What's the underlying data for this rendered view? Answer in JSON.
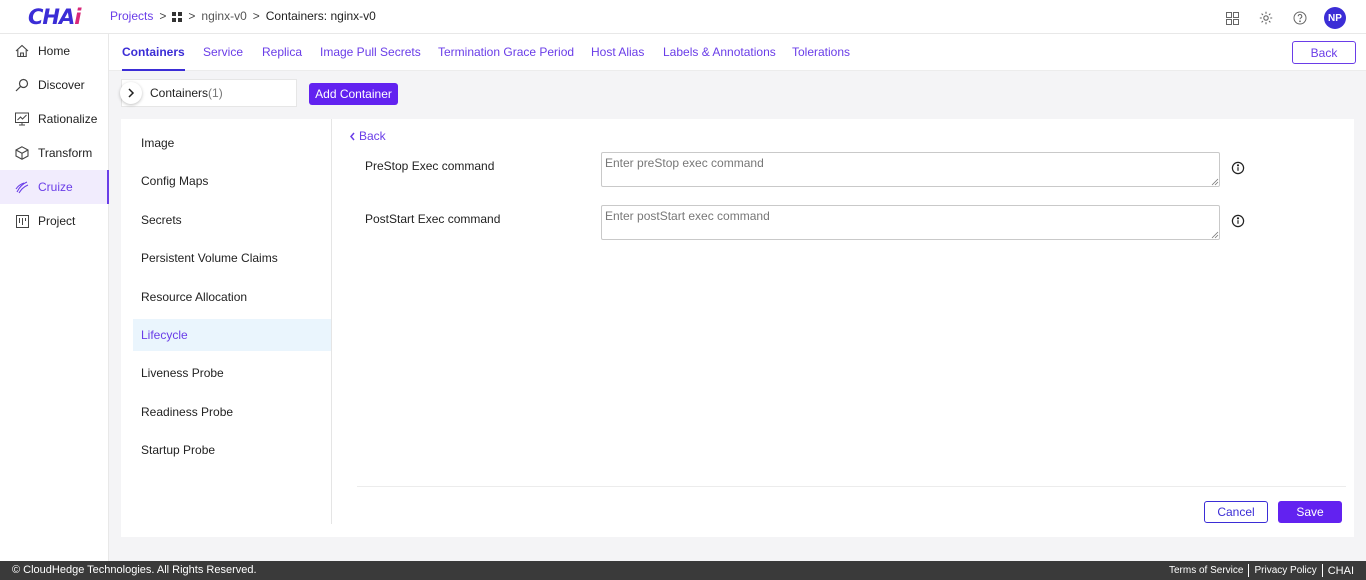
{
  "app": {
    "logo_text": "CHA",
    "logo_accent": "i"
  },
  "breadcrumb": {
    "projects": "Projects",
    "sep": ">",
    "project": "nginx-v0",
    "current": "Containers: nginx-v0"
  },
  "header": {
    "icons": [
      "apps-grid-icon",
      "settings-icon",
      "help-icon"
    ],
    "avatar_initials": "NP"
  },
  "sidebar": {
    "items": [
      {
        "label": "Home",
        "icon": "home-icon"
      },
      {
        "label": "Discover",
        "icon": "discover-icon"
      },
      {
        "label": "Rationalize",
        "icon": "rationalize-icon"
      },
      {
        "label": "Transform",
        "icon": "cube-icon"
      },
      {
        "label": "Cruize",
        "icon": "cruize-icon",
        "active": true
      },
      {
        "label": "Project",
        "icon": "project-icon"
      }
    ]
  },
  "tabs": {
    "items": [
      "Containers",
      "Service",
      "Replica",
      "Image Pull Secrets",
      "Termination Grace Period",
      "Host Alias",
      "Labels & Annotations",
      "Tolerations"
    ],
    "active": "Containers",
    "back_label": "Back"
  },
  "containers": {
    "label": "Containers",
    "count": "(1)",
    "add_label": "Add Container"
  },
  "sub_nav": {
    "items": [
      "Image",
      "Config Maps",
      "Secrets",
      "Persistent Volume Claims",
      "Resource Allocation",
      "Lifecycle",
      "Liveness Probe",
      "Readiness Probe",
      "Startup Probe"
    ],
    "active": "Lifecycle"
  },
  "lifecycle": {
    "back_label": "Back",
    "prestop_label": "PreStop Exec command",
    "prestop_placeholder": "Enter preStop exec command",
    "poststart_label": "PostStart Exec command",
    "poststart_placeholder": "Enter postStart exec command",
    "cancel_label": "Cancel",
    "save_label": "Save"
  },
  "footer": {
    "copyright": "© CloudHedge Technologies. All Rights Reserved.",
    "terms": "Terms of Service",
    "privacy": "Privacy Policy",
    "brand": "CHAI"
  },
  "colors": {
    "accent": "#6a3de8",
    "primary_button": "#6222f0",
    "brand_blue": "#3b2dd6",
    "brand_pink": "#d8287a",
    "active_subnav_bg": "#eaf5fd",
    "footer_bg": "#3a3a3a"
  }
}
